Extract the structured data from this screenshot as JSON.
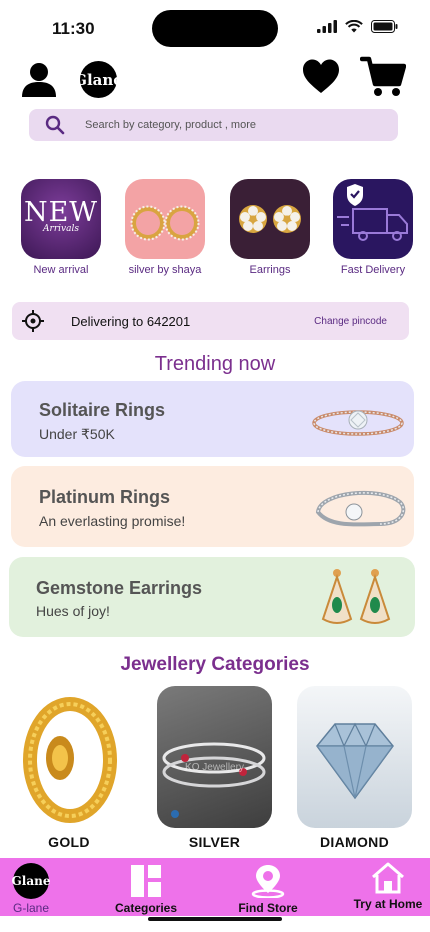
{
  "status": {
    "time": "11:30"
  },
  "header": {
    "logo_text": "Glane"
  },
  "search": {
    "placeholder": "Search by category, product , more"
  },
  "stories": [
    {
      "label": "New arrival",
      "tile_text": "NEW",
      "tile_sub": "Arrivals"
    },
    {
      "label": "silver by shaya"
    },
    {
      "label": "Earrings"
    },
    {
      "label": "Fast Delivery"
    }
  ],
  "delivery": {
    "text": "Delivering to 642201",
    "change_label": "Change pincode"
  },
  "trending": {
    "title": "Trending now",
    "promos": [
      {
        "title": "Solitaire Rings",
        "subtitle": "Under ₹50K",
        "bg": "#e4e2fb"
      },
      {
        "title": "Platinum Rings",
        "subtitle": "An everlasting promise!",
        "bg": "#fdece0"
      },
      {
        "title": "Gemstone Earrings",
        "subtitle": "Hues of joy!",
        "bg": "#e2f1dd"
      }
    ]
  },
  "categories": {
    "title": "Jewellery Categories",
    "items": [
      {
        "label": "GOLD"
      },
      {
        "label": "SILVER",
        "watermark": "KO Jewellery"
      },
      {
        "label": "DIAMOND"
      }
    ]
  },
  "nav": {
    "items": [
      {
        "label": "G-lane",
        "logo_text": "Glane"
      },
      {
        "label": "Categories"
      },
      {
        "label": "Find Store"
      },
      {
        "label": "Try at Home"
      }
    ]
  },
  "colors": {
    "accent": "#7b2f8e",
    "nav_bg": "#ee72ea",
    "search_bg": "#eadaf0"
  }
}
